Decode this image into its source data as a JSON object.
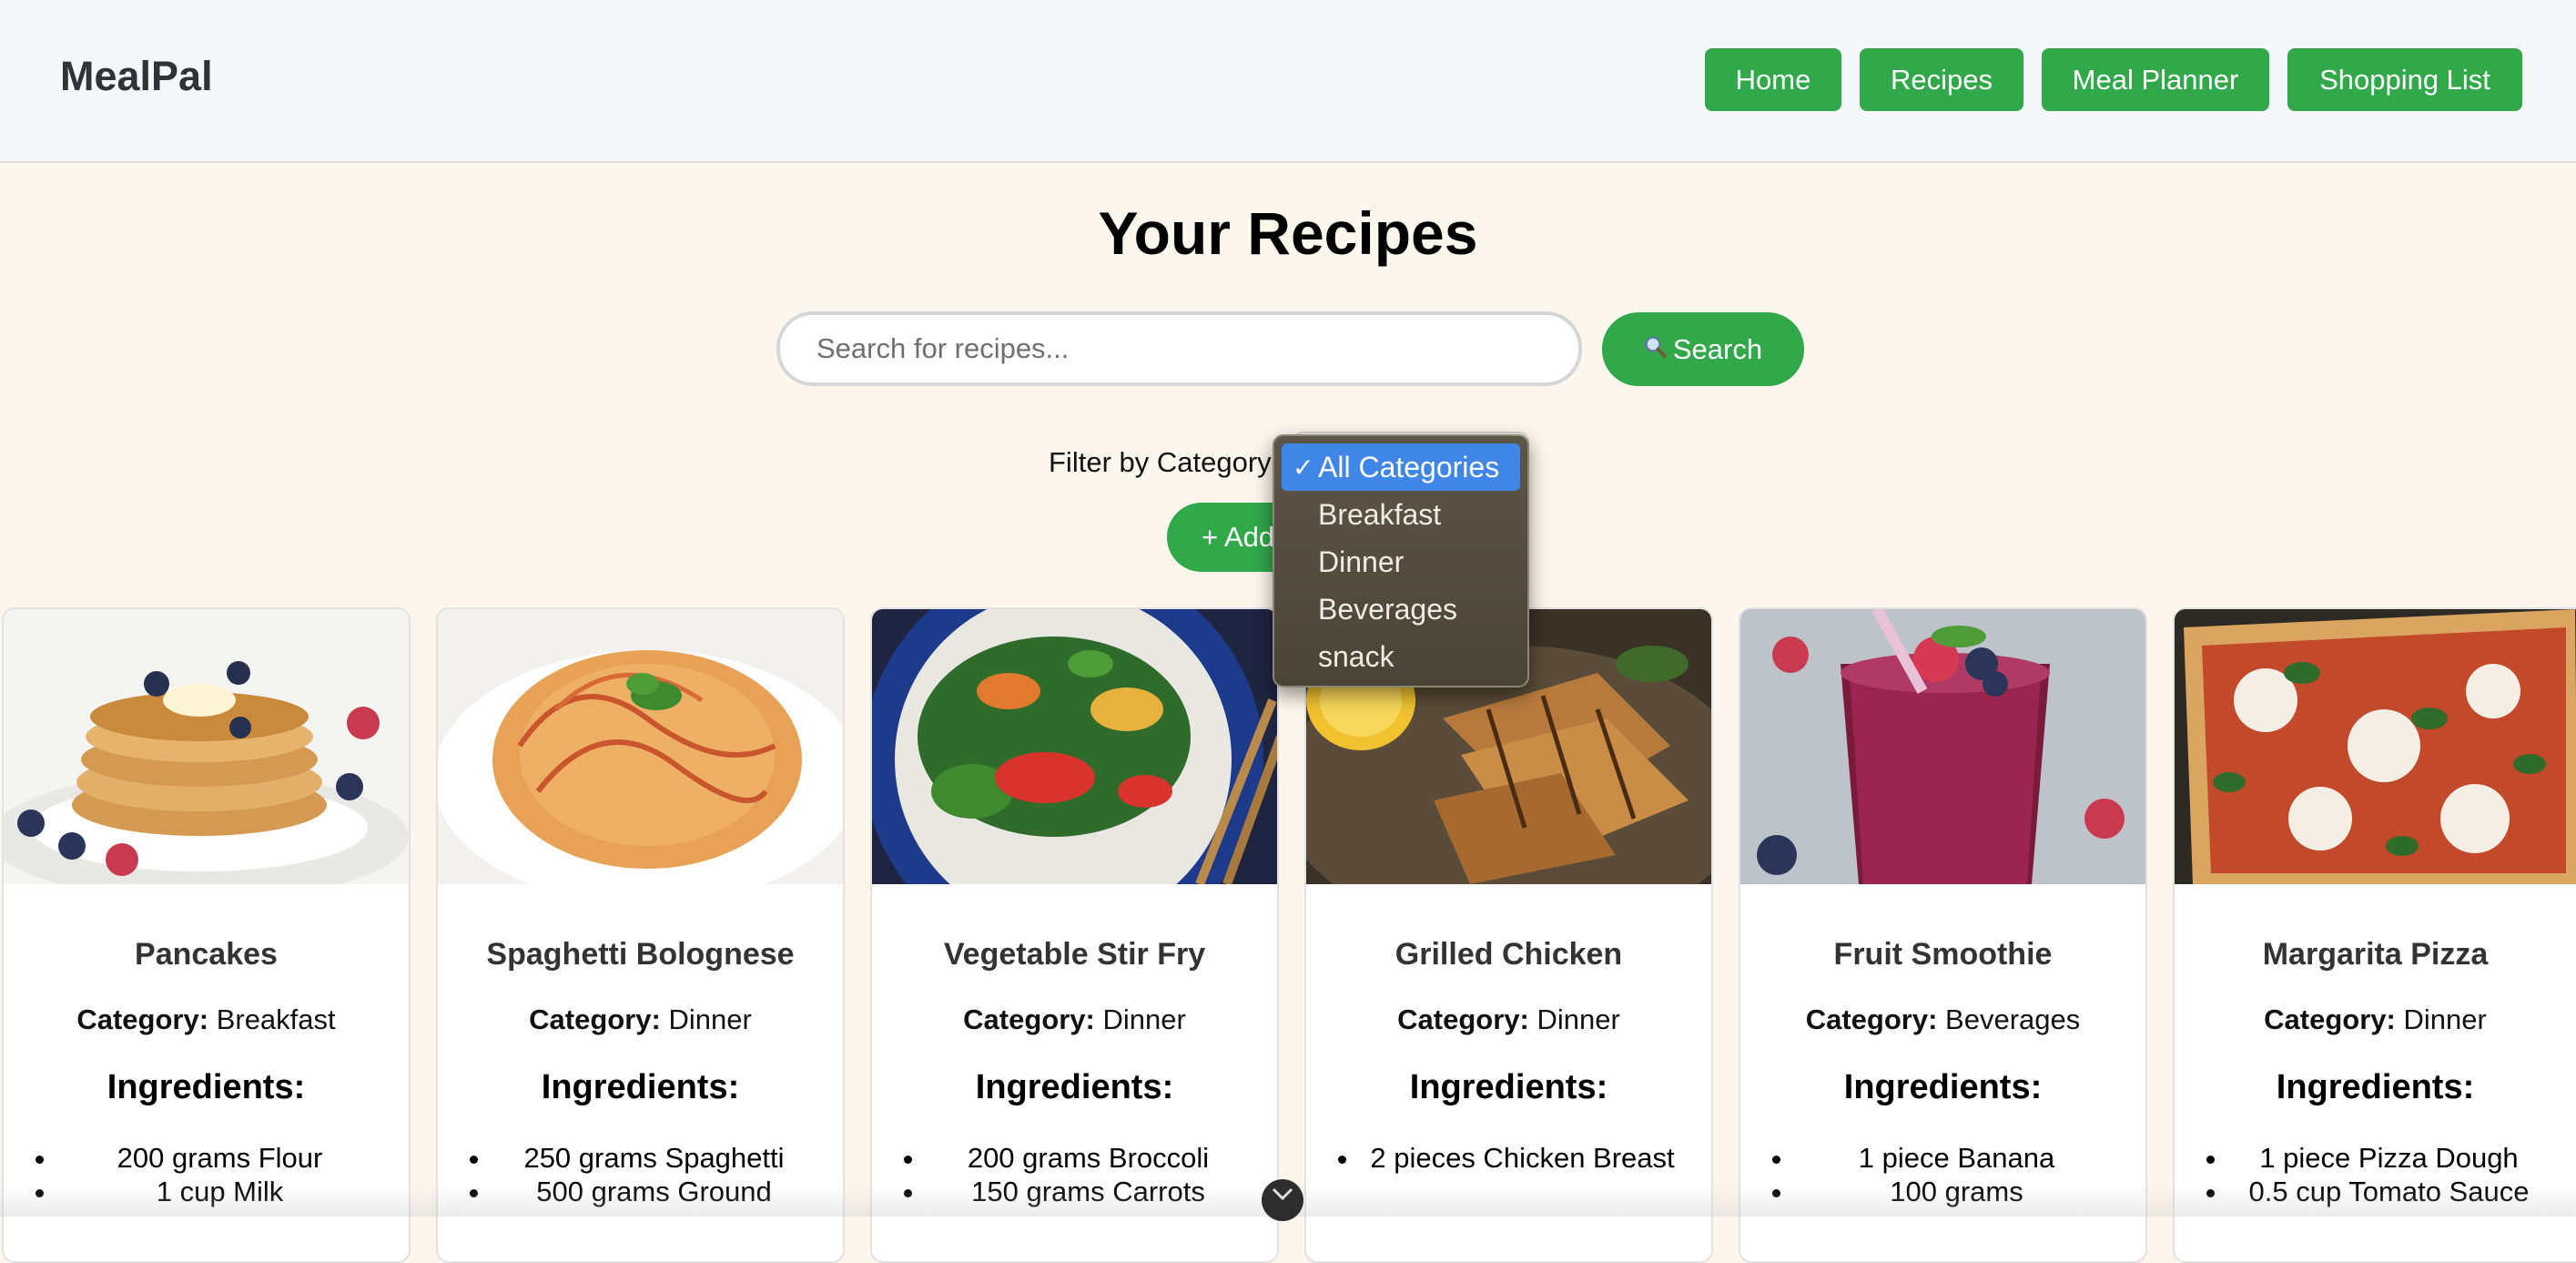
{
  "header": {
    "brand": "MealPal",
    "nav": [
      "Home",
      "Recipes",
      "Meal Planner",
      "Shopping List"
    ]
  },
  "main": {
    "title": "Your Recipes",
    "search": {
      "placeholder": "Search for recipes...",
      "button_label": "Search",
      "button_icon": "magnifier-icon"
    },
    "filter": {
      "label": "Filter by Category:",
      "options": [
        "All Categories",
        "Breakfast",
        "Dinner",
        "Beverages",
        "snack"
      ],
      "selected": "All Categories",
      "check": "✓"
    },
    "add_button": "+ Add"
  },
  "recipes": [
    {
      "name": "Pancakes",
      "category_label": "Category:",
      "category": "Breakfast",
      "ingredients_heading": "Ingredients:",
      "ingredients": [
        "200 grams Flour",
        "1 cup Milk"
      ]
    },
    {
      "name": "Spaghetti Bolognese",
      "category_label": "Category:",
      "category": "Dinner",
      "ingredients_heading": "Ingredients:",
      "ingredients": [
        "250 grams Spaghetti",
        "500 grams Ground"
      ]
    },
    {
      "name": "Vegetable Stir Fry",
      "category_label": "Category:",
      "category": "Dinner",
      "ingredients_heading": "Ingredients:",
      "ingredients": [
        "200 grams Broccoli",
        "150 grams Carrots"
      ]
    },
    {
      "name": "Grilled Chicken",
      "category_label": "Category:",
      "category": "Dinner",
      "ingredients_heading": "Ingredients:",
      "ingredients": [
        "2 pieces Chicken Breast"
      ]
    },
    {
      "name": "Fruit Smoothie",
      "category_label": "Category:",
      "category": "Beverages",
      "ingredients_heading": "Ingredients:",
      "ingredients": [
        "1 piece Banana",
        "100 grams"
      ]
    },
    {
      "name": "Margarita Pizza",
      "category_label": "Category:",
      "category": "Dinner",
      "ingredients_heading": "Ingredients:",
      "ingredients": [
        "1 piece Pizza Dough",
        "0.5 cup Tomato Sauce"
      ]
    }
  ],
  "colors": {
    "accent": "#31a84a",
    "page_bg": "#fcf7ed",
    "header_bg": "#f5f7fa",
    "dropdown_selected": "#3f86e6"
  }
}
